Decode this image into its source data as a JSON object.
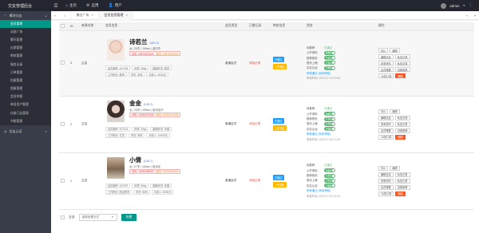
{
  "app": {
    "title": "交友管理后台"
  },
  "topnav": {
    "home": "主页",
    "app": "应用",
    "user": "用户",
    "admin": "admin"
  },
  "sidebar": {
    "group1": "模块交友",
    "items": [
      "会员管理",
      "动态广场",
      "聊天管理",
      "红娘管理",
      "审核管理",
      "服务记录",
      "订单管理",
      "档案管理",
      "相册管理",
      "会员举报",
      "单身用户管理",
      "红娘门店管理",
      "节能管理"
    ],
    "group2": "交友认证"
  },
  "tabs": {
    "tab1": "播出广场",
    "tab2": "会员信息管理"
  },
  "table": {
    "headers": [
      "",
      "ID",
      "来源名称",
      "会员信息",
      "",
      "",
      "会员类型",
      "已婚记录",
      "审核信息",
      "状态",
      "操作"
    ],
    "rows": [
      {
        "id": "3",
        "source": "主站",
        "name": "诗若兰",
        "uid": "(UID:3)",
        "line1": "女 | 28岁 | 156cm | 潍坊市",
        "phone": "手机: 15874512541",
        "wechat": "微信: 15874512541",
        "tags": [
          "会员编号: 107138",
          "体重: 45kg",
          "婚姻状况: 离异",
          "工作职业: 教师",
          "学历: 本科",
          "月收入: 5000元"
        ],
        "member_type": "普通会员",
        "record": "添加记录",
        "audit1": "已通过",
        "audit2": "上传通过",
        "status": [
          "已通过",
          "未推荐",
          "已显示",
          "已显示",
          "已删除"
        ],
        "status_labels": [
          "待推荐: ",
          "公开资料: ",
          "推荐首页: ",
          "首页上墙: ",
          "实名认证: "
        ],
        "audit_time": "审核时间: 2023-07-03 20:54",
        "audit_note": "审核通过 (系统审核)"
      },
      {
        "id": "2",
        "source": "主站",
        "name": "金金",
        "uid": "(UID:2)",
        "line1": "女 | 25岁 | 158cm | 临沭县市",
        "phone": "手机: 15265475456",
        "wechat": "微信: 15265475456",
        "tags": [
          "会员编号: 107124",
          "体重: 40kg",
          "婚姻状况: 未婚",
          "工作职业: 文员",
          "学历: 本科",
          "月收入: 10000元"
        ],
        "member_type": "普通会员",
        "record": "添加记录",
        "audit1": "已通过",
        "audit2": "上传通过",
        "status": [
          "已通过",
          "未推荐",
          "已显示",
          "已显示",
          "已删除"
        ],
        "status_labels": [
          "待推荐: ",
          "公开资料: ",
          "推荐首页: ",
          "首页上墙: ",
          "实名认证: "
        ],
        "audit_time": "审核时间: 2023-07-02 17:09",
        "audit_note": "审核通过 (系统审核)"
      },
      {
        "id": "1",
        "source": "主站",
        "name": "小倩",
        "uid": "(UID:1)",
        "line1": "女 | 27岁 | 165cm | 临沭区",
        "phone": "手机: 15265458262",
        "wechat": "微信: 15265458262",
        "tags": [
          "会员编号: 102379",
          "体重: 50kg",
          "婚姻状况: 未婚",
          "工作职业: 国企职员",
          "学历: 本科",
          "月收入: 8000元"
        ],
        "member_type": "普通会员",
        "record": "添加记录",
        "audit1": "已通过",
        "audit2": "上传通过",
        "status": [
          "已通过",
          "未推荐",
          "已显示",
          "已显示",
          "已删除"
        ],
        "status_labels": [
          "待推荐: ",
          "公开资料: ",
          "推荐首页: ",
          "首页上墙: ",
          "实名认证: "
        ],
        "audit_time": "审核时间: 2023-07-01 15:21",
        "audit_note": "审核通过 (系统审核)"
      }
    ],
    "ops": [
      [
        "评价",
        "编辑"
      ],
      [
        "编辑信息",
        "私信记录"
      ],
      [
        "查看资料",
        "私信记录"
      ],
      [
        "会员概要",
        "设置推荐"
      ],
      [
        "TA的订单",
        "删除"
      ]
    ]
  },
  "footer": {
    "select_all": "全选",
    "select_placeholder": "选择处理方式",
    "submit": "处理"
  },
  "colors": {
    "sidebar_active": "#009688",
    "switch_on": "#5fb878",
    "danger": "#ff5722"
  }
}
